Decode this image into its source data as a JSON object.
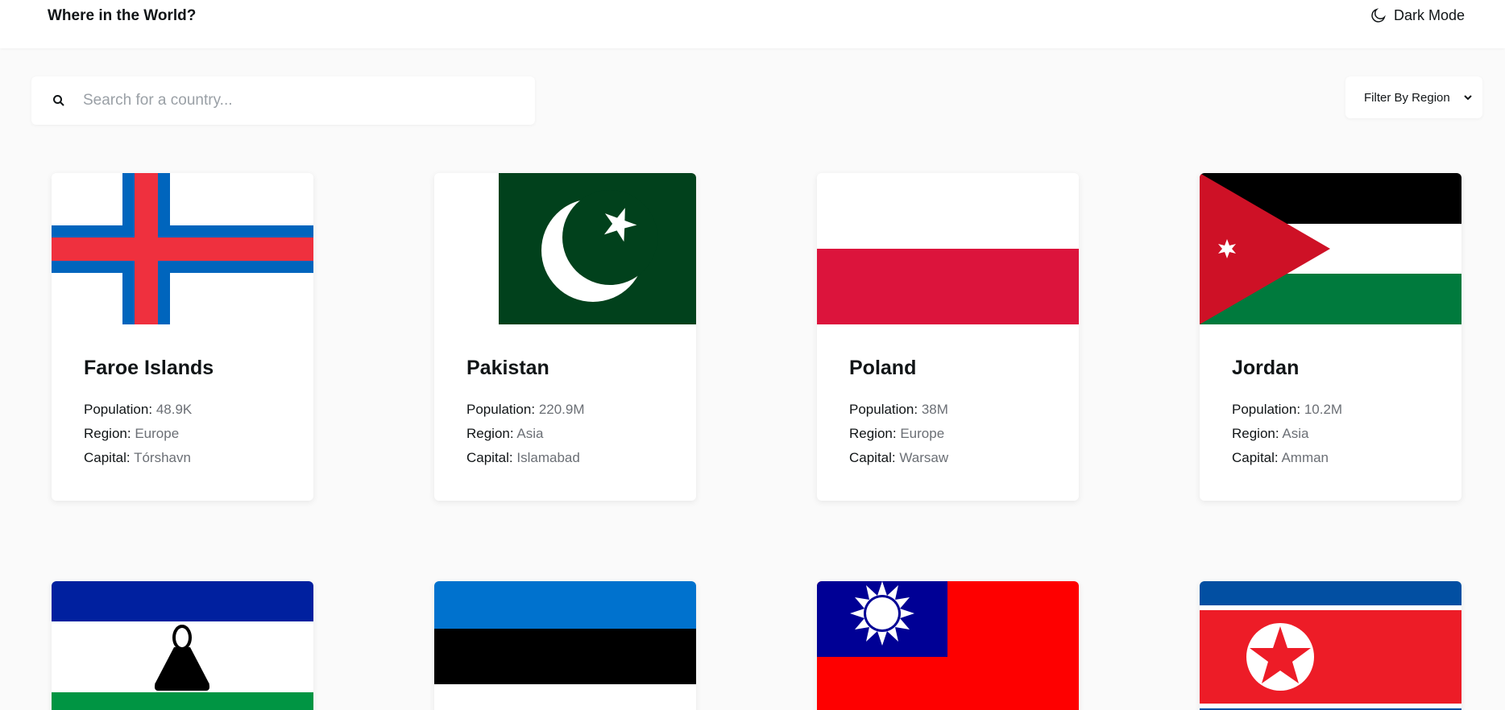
{
  "header": {
    "title": "Where in the World?",
    "dark_mode_label": "Dark Mode"
  },
  "search": {
    "placeholder": "Search for a country..."
  },
  "filter": {
    "label": "Filter By Region"
  },
  "labels": {
    "population": "Population:",
    "region": "Region:",
    "capital": "Capital:"
  },
  "countries": [
    {
      "name": "Faroe Islands",
      "population": "48.9K",
      "region": "Europe",
      "capital": "Tórshavn",
      "flag": "faroe-islands-flag"
    },
    {
      "name": "Pakistan",
      "population": "220.9M",
      "region": "Asia",
      "capital": "Islamabad",
      "flag": "pakistan-flag"
    },
    {
      "name": "Poland",
      "population": "38M",
      "region": "Europe",
      "capital": "Warsaw",
      "flag": "poland-flag"
    },
    {
      "name": "Jordan",
      "population": "10.2M",
      "region": "Asia",
      "capital": "Amman",
      "flag": "jordan-flag"
    },
    {
      "flag": "lesotho-flag"
    },
    {
      "flag": "estonia-flag"
    },
    {
      "flag": "taiwan-flag"
    },
    {
      "flag": "north-korea-flag"
    }
  ],
  "colors": {
    "background": "#fafafa",
    "card": "#ffffff",
    "text": "#111517",
    "muted": "#6b6f75"
  }
}
